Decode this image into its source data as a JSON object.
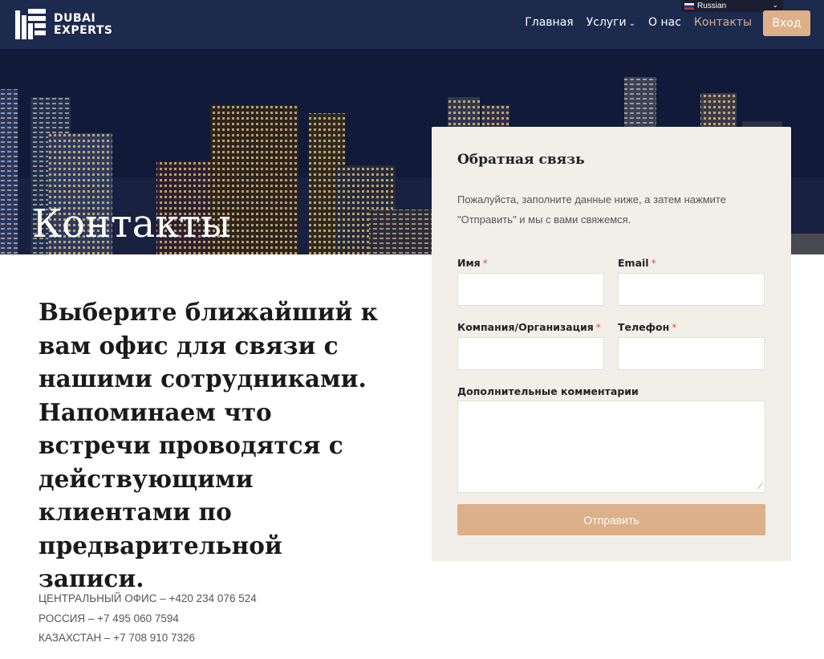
{
  "header": {
    "logo_line1": "DUBAI",
    "logo_line2": "EXPERTS",
    "nav": [
      {
        "label": "Главная"
      },
      {
        "label": "Услуги"
      },
      {
        "label": "О нас"
      },
      {
        "label": "Контакты"
      }
    ],
    "login_label": "Вход",
    "language": "Russian",
    "accent_color": "#deb088",
    "bg_color": "#1c2a4d"
  },
  "hero": {
    "title": "Контакты"
  },
  "intro": {
    "text": "Выберите ближайший к вам офис для связи с нашими сотрудниками. Напоминаем что встречи проводятся с действующими клиентами по предварительной записи."
  },
  "offices": [
    {
      "text": "ЦЕНТРАЛЬНЫЙ ОФИС – +420 234 076 524"
    },
    {
      "text": "РОССИЯ – +7 495 060 7594"
    },
    {
      "text": "КАЗАХСТАН – +7 708 910 7326"
    }
  ],
  "form": {
    "title": "Обратная связь",
    "description": "Пожалуйста, заполните данные ниже, а затем нажмите \"Отправить\" и мы с вами свяжемся.",
    "fields": {
      "name": {
        "label": "Имя",
        "required_mark": "*"
      },
      "email": {
        "label": "Email",
        "required_mark": "*"
      },
      "company": {
        "label": "Компания/Организация",
        "required_mark": "*"
      },
      "phone": {
        "label": "Телефон",
        "required_mark": "*"
      },
      "comments": {
        "label": "Дополнительные комментарии"
      }
    },
    "submit_label": "Отправить"
  }
}
